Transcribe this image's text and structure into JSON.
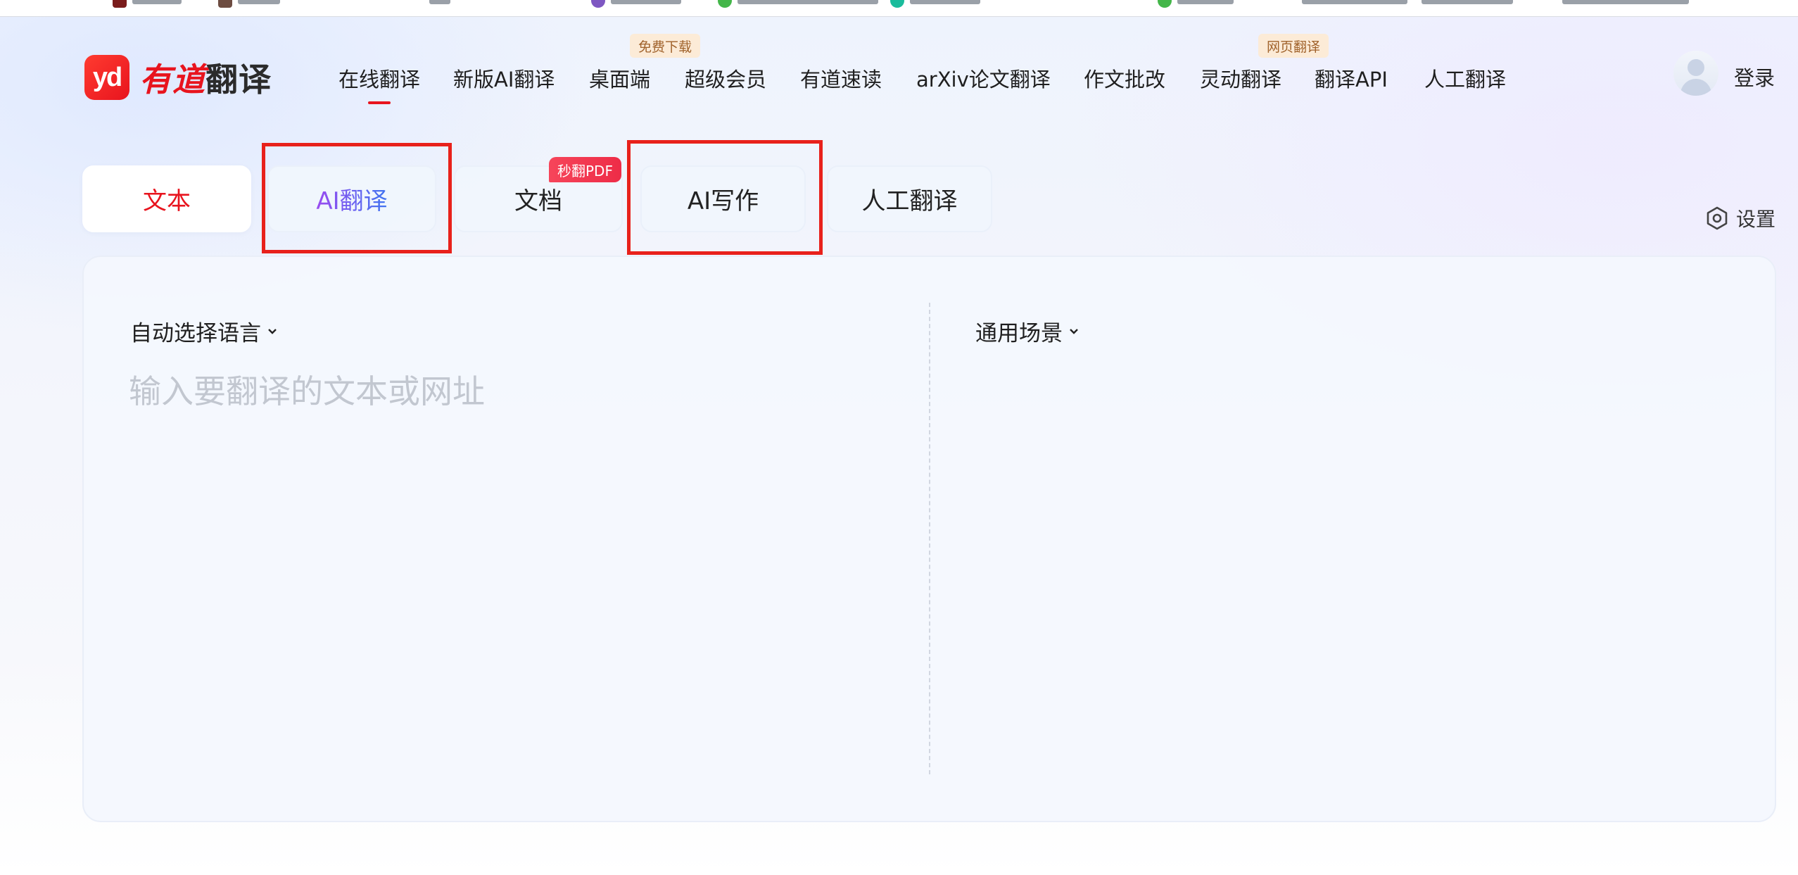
{
  "header": {
    "logo_mark": "yd",
    "logo_text_red": "有道",
    "logo_text_dark": "翻译",
    "nav": [
      {
        "label": "在线翻译",
        "active": true
      },
      {
        "label": "新版AI翻译"
      },
      {
        "label": "桌面端",
        "badge": "免费下载"
      },
      {
        "label": "超级会员"
      },
      {
        "label": "有道速读"
      },
      {
        "label": "arXiv论文翻译"
      },
      {
        "label": "作文批改"
      },
      {
        "label": "灵动翻译",
        "badge": "网页翻译"
      },
      {
        "label": "翻译API"
      },
      {
        "label": "人工翻译"
      }
    ],
    "login_label": "登录"
  },
  "tabs": [
    {
      "label": "文本",
      "active": true
    },
    {
      "label": "AI翻译",
      "highlighted": true
    },
    {
      "label": "文档",
      "badge": "秒翻PDF"
    },
    {
      "label": "AI写作",
      "highlighted": true
    },
    {
      "label": "人工翻译"
    }
  ],
  "settings_label": "设置",
  "source": {
    "language_select": "自动选择语言",
    "placeholder": "输入要翻译的文本或网址"
  },
  "target": {
    "scene_select": "通用场景"
  },
  "colors": {
    "brand_red": "#e8141e",
    "highlight_box": "#e8211b",
    "ai_gradient_start": "#9a4bf0",
    "ai_gradient_end": "#3f74f0"
  },
  "icons": [
    "youdao-logo-icon",
    "avatar-icon",
    "settings-gear-icon",
    "chevron-down-icon"
  ]
}
